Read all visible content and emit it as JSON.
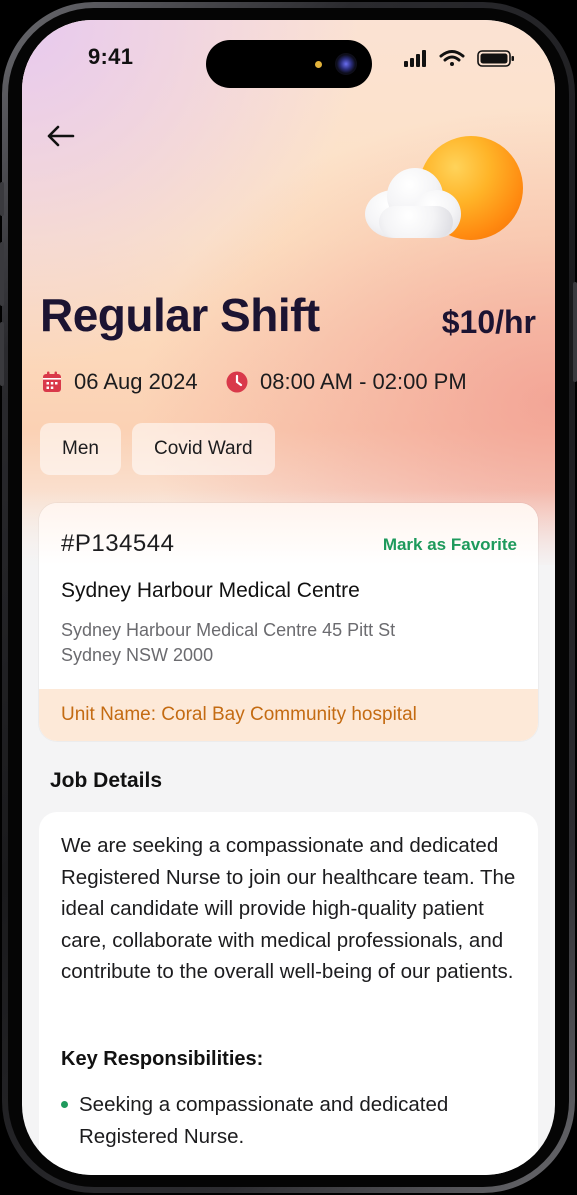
{
  "status_bar": {
    "time": "9:41"
  },
  "shift": {
    "title": "Regular Shift",
    "rate": "$10/hr",
    "date": "06 Aug 2024",
    "time_range": "08:00 AM - 02:00 PM",
    "tags": [
      "Men",
      "Covid Ward"
    ]
  },
  "facility_card": {
    "id": "#P134544",
    "favorite_label": "Mark as Favorite",
    "name": "Sydney Harbour Medical Centre",
    "address": "Sydney Harbour Medical Centre 45 Pitt St Sydney NSW 2000",
    "unit": "Unit Name: Coral Bay Community hospital"
  },
  "job_details": {
    "heading": "Job Details",
    "description": "We are seeking a compassionate and dedicated Registered Nurse to join our healthcare team. The ideal candidate will provide high-quality patient care, collaborate with medical professionals, and contribute to the overall well-being of our patients.",
    "responsibilities_heading": "Key Responsibilities:",
    "responsibilities": [
      "Seeking a compassionate and dedicated Registered Nurse."
    ]
  },
  "icons": {
    "back": "arrow-left-icon",
    "weather": "partly-sunny-icon",
    "date": "calendar-icon",
    "time": "clock-icon"
  },
  "colors": {
    "accent_green": "#1e9a5c",
    "unit_orange": "#c46b12",
    "icon_red": "#d9394a",
    "title_dark": "#1c1432"
  }
}
